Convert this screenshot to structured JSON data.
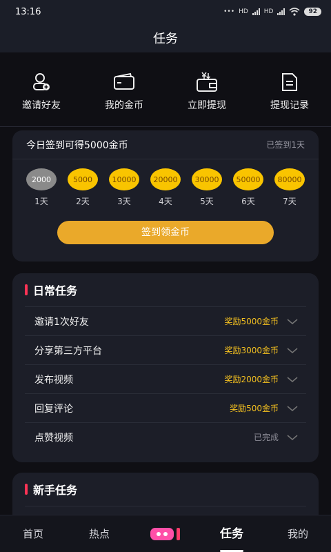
{
  "status_bar": {
    "time": "13:16",
    "network": "HD",
    "battery": "92"
  },
  "title": "任务",
  "quick_actions": [
    {
      "label": "邀请好友",
      "icon": "invite-user-icon"
    },
    {
      "label": "我的金币",
      "icon": "wallet-icon"
    },
    {
      "label": "立即提现",
      "icon": "withdraw-wallet-icon"
    },
    {
      "label": "提现记录",
      "icon": "document-icon"
    }
  ],
  "checkin": {
    "title": "今日签到可得5000金币",
    "status": "已签到1天",
    "coins": [
      {
        "amount": "2000",
        "day": "1天",
        "done": true
      },
      {
        "amount": "5000",
        "day": "2天",
        "done": false
      },
      {
        "amount": "10000",
        "day": "3天",
        "done": false
      },
      {
        "amount": "20000",
        "day": "4天",
        "done": false
      },
      {
        "amount": "30000",
        "day": "5天",
        "done": false
      },
      {
        "amount": "50000",
        "day": "6天",
        "done": false
      },
      {
        "amount": "80000",
        "day": "7天",
        "done": false
      }
    ],
    "button": "签到领金币"
  },
  "daily_tasks": {
    "title": "日常任务",
    "items": [
      {
        "name": "邀请1次好友",
        "reward": "奖励5000金币"
      },
      {
        "name": "分享第三方平台",
        "reward": "奖励3000金币"
      },
      {
        "name": "发布视频",
        "reward": "奖励2000金币"
      },
      {
        "name": "回复评论",
        "reward": "奖励500金币"
      },
      {
        "name": "点赞视频",
        "reward": "已完成"
      }
    ]
  },
  "newbie_tasks": {
    "title": "新手任务"
  },
  "tabs": {
    "home": "首页",
    "hot": "热点",
    "task": "任务",
    "me": "我的"
  },
  "colors": {
    "accent": "#eaa92a",
    "coin": "#f9c400",
    "reward": "#f4c020",
    "section_bar": "#ff3355"
  }
}
